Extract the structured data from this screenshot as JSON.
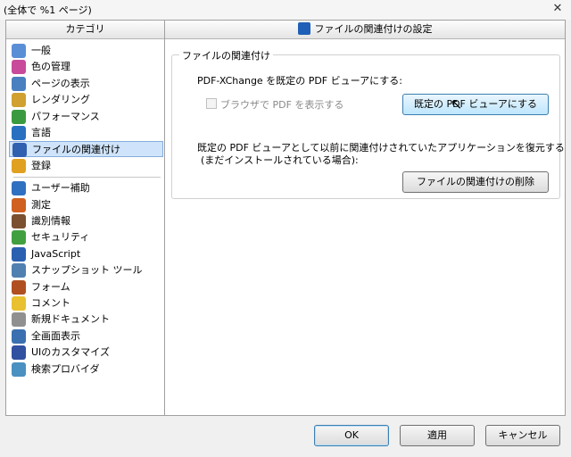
{
  "window": {
    "title": "(全体で %1 ページ)",
    "close_glyph": "✕"
  },
  "categories": {
    "header": "カテゴリ",
    "items": [
      {
        "label": "一般",
        "icon": "general-icon",
        "color": "#5a8fd6"
      },
      {
        "label": "色の管理",
        "icon": "color-management-icon",
        "color": "#c84a9a"
      },
      {
        "label": "ページの表示",
        "icon": "page-display-icon",
        "color": "#4a7fc0"
      },
      {
        "label": "レンダリング",
        "icon": "rendering-icon",
        "color": "#d0a030"
      },
      {
        "label": "パフォーマンス",
        "icon": "performance-icon",
        "color": "#3a9a40"
      },
      {
        "label": "言語",
        "icon": "language-icon",
        "color": "#2a70c0"
      },
      {
        "label": "ファイルの関連付け",
        "icon": "file-association-icon",
        "color": "#3060b0",
        "selected": true
      },
      {
        "label": "登録",
        "icon": "registration-icon",
        "color": "#e0a020"
      },
      {
        "label": "ユーザー補助",
        "icon": "accessibility-icon",
        "color": "#3070c0"
      },
      {
        "label": "測定",
        "icon": "measure-icon",
        "color": "#d06020"
      },
      {
        "label": "識別情報",
        "icon": "identity-icon",
        "color": "#7a5030"
      },
      {
        "label": "セキュリティ",
        "icon": "security-icon",
        "color": "#40a040"
      },
      {
        "label": "JavaScript",
        "icon": "javascript-icon",
        "color": "#2a60b0"
      },
      {
        "label": "スナップショット ツール",
        "icon": "snapshot-tool-icon",
        "color": "#5080b0"
      },
      {
        "label": "フォーム",
        "icon": "form-icon",
        "color": "#b05020"
      },
      {
        "label": "コメント",
        "icon": "comment-icon",
        "color": "#e8c030"
      },
      {
        "label": "新規ドキュメント",
        "icon": "new-document-icon",
        "color": "#909090"
      },
      {
        "label": "全画面表示",
        "icon": "full-screen-icon",
        "color": "#3a70b0"
      },
      {
        "label": "UIのカスタマイズ",
        "icon": "ui-customize-icon",
        "color": "#3050a0"
      },
      {
        "label": "検索プロバイダ",
        "icon": "search-provider-icon",
        "color": "#4a90c0"
      }
    ]
  },
  "panel": {
    "header": "ファイルの関連付けの設定",
    "group_title": "ファイルの関連付け",
    "default_viewer_text": "PDF-XChange を既定の PDF ビューアにする:",
    "browser_checkbox_label": "ブラウザで PDF を表示する",
    "browser_checkbox_checked": false,
    "set_default_button": "既定の PDF ビューアにする",
    "restore_text_line1": "既定の PDF ビューアとして以前に関連付けされていたアプリケーションを復元する",
    "restore_text_line2": "(まだインストールされている場合):",
    "remove_button": "ファイルの関連付けの削除"
  },
  "footer": {
    "ok": "OK",
    "apply": "適用",
    "cancel": "キャンセル"
  }
}
